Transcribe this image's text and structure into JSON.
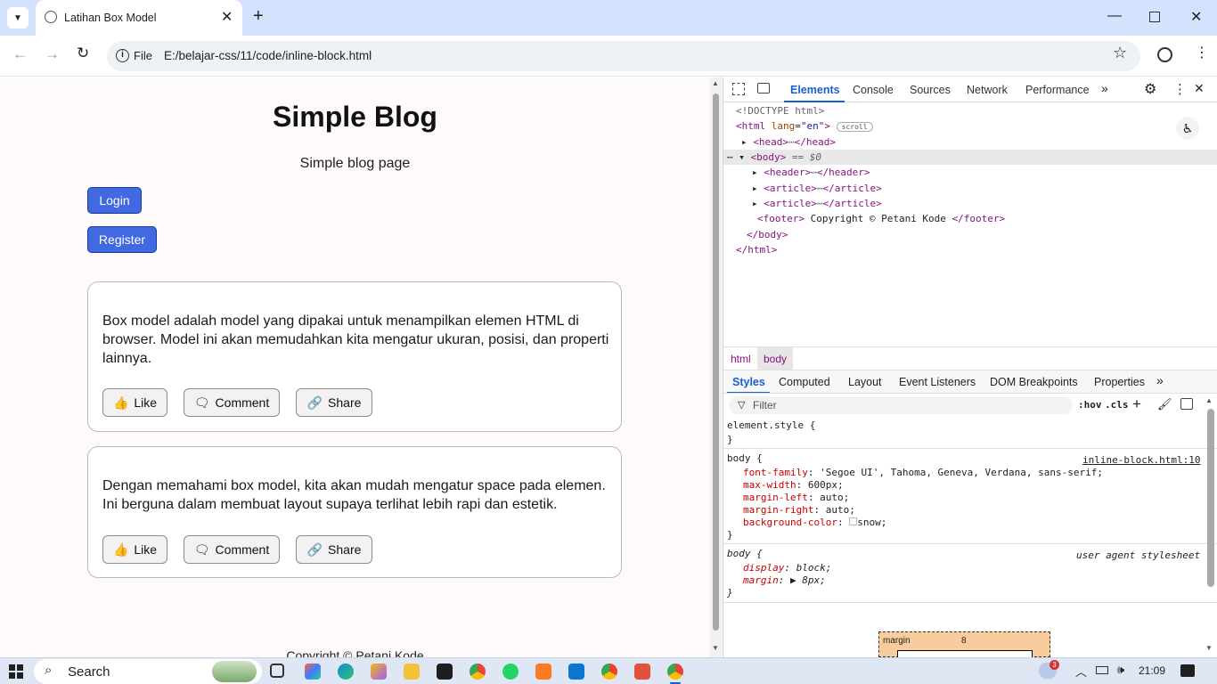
{
  "browser": {
    "tab_title": "Latihan Box Model",
    "site_chip": "File",
    "url": "E:/belajar-css/11/code/inline-block.html"
  },
  "page": {
    "title": "Simple Blog",
    "subtitle": "Simple blog page",
    "login_label": "Login",
    "register_label": "Register",
    "articles": [
      {
        "text": "Box model adalah model yang dipakai untuk menampilkan elemen HTML di browser. Model ini akan memudahkan kita mengatur ukuran, posisi, dan properti lainnya.",
        "like": "Like",
        "comment": "Comment",
        "share": "Share"
      },
      {
        "text": "Dengan memahami box model, kita akan mudah mengatur space pada elemen. Ini berguna dalam membuat layout supaya terlihat lebih rapi dan estetik.",
        "like": "Like",
        "comment": "Comment",
        "share": "Share"
      }
    ],
    "footer": "Copyright © Petani Kode"
  },
  "devtools": {
    "tabs": [
      "Elements",
      "Console",
      "Sources",
      "Network",
      "Performance"
    ],
    "dom": {
      "doctype": "<!DOCTYPE html>",
      "html_open": "<html",
      "html_attr": "lang",
      "html_val": "\"en\"",
      "scroll_badge": "scroll",
      "head": "<head>",
      "head_close": "</head>",
      "body": "<body>",
      "body_sel": "== $0",
      "header": "<header>",
      "header_close": "</header>",
      "article": "<article>",
      "article_close": "</article>",
      "footer_open": "<footer>",
      "footer_text": " Copyright © Petani Kode ",
      "footer_close": "</footer>",
      "body_close": "</body>",
      "html_close": "</html>",
      "ellipsis": "⋯"
    },
    "breadcrumbs": [
      "html",
      "body"
    ],
    "subtabs": [
      "Styles",
      "Computed",
      "Layout",
      "Event Listeners",
      "DOM Breakpoints",
      "Properties"
    ],
    "filter_placeholder": "Filter",
    "hov": ":hov",
    "cls": ".cls",
    "styles": {
      "element_style": "element.style {",
      "close": "}",
      "rule1_selector": "body {",
      "rule1_source": "inline-block.html:10",
      "rule1": [
        [
          "font-family",
          "'Segoe UI', Tahoma, Geneva, Verdana, sans-serif;"
        ],
        [
          "max-width",
          "600px;"
        ],
        [
          "margin-left",
          "auto;"
        ],
        [
          "margin-right",
          "auto;"
        ],
        [
          "background-color",
          "snow;"
        ]
      ],
      "rule2_selector": "body {",
      "rule2_source": "user agent stylesheet",
      "rule2": [
        [
          "display",
          "block;"
        ],
        [
          "margin",
          "8px;"
        ]
      ]
    },
    "boxmodel": {
      "label": "margin",
      "value": "8"
    }
  },
  "taskbar": {
    "search": "Search",
    "time": "21:09",
    "badge": "3"
  },
  "colors": {
    "accent": "#4169e1",
    "tab_strip": "#d3e3fd",
    "page_bg": "#fffafa"
  }
}
